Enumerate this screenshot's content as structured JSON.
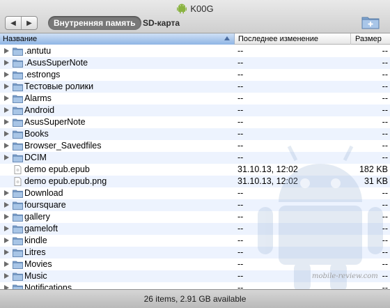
{
  "window": {
    "title": "K00G"
  },
  "toolbar": {
    "back_label": "◀",
    "forward_label": "▶",
    "tab_internal": "Внутренняя память",
    "tab_sd": "SD-карта"
  },
  "columns": {
    "name": "Название",
    "modified": "Последнее изменение",
    "size": "Размер"
  },
  "rows": [
    {
      "type": "folder",
      "name": ".antutu",
      "modified": "--",
      "size": "--"
    },
    {
      "type": "folder",
      "name": ".AsusSuperNote",
      "modified": "--",
      "size": "--"
    },
    {
      "type": "folder",
      "name": ".estrongs",
      "modified": "--",
      "size": "--"
    },
    {
      "type": "folder",
      "name": "Тестовые ролики",
      "modified": "--",
      "size": "--"
    },
    {
      "type": "folder",
      "name": "Alarms",
      "modified": "--",
      "size": "--"
    },
    {
      "type": "folder",
      "name": "Android",
      "modified": "--",
      "size": "--"
    },
    {
      "type": "folder",
      "name": "AsusSuperNote",
      "modified": "--",
      "size": "--"
    },
    {
      "type": "folder",
      "name": "Books",
      "modified": "--",
      "size": "--"
    },
    {
      "type": "folder",
      "name": "Browser_Savedfiles",
      "modified": "--",
      "size": "--"
    },
    {
      "type": "folder",
      "name": "DCIM",
      "modified": "--",
      "size": "--"
    },
    {
      "type": "file",
      "name": "demo epub.epub",
      "modified": "31.10.13, 12:02",
      "size": "182 KB"
    },
    {
      "type": "file",
      "name": "demo epub.epub.png",
      "modified": "31.10.13, 12:02",
      "size": "31 KB"
    },
    {
      "type": "folder",
      "name": "Download",
      "modified": "--",
      "size": "--"
    },
    {
      "type": "folder",
      "name": "foursquare",
      "modified": "--",
      "size": "--"
    },
    {
      "type": "folder",
      "name": "gallery",
      "modified": "--",
      "size": "--"
    },
    {
      "type": "folder",
      "name": "gameloft",
      "modified": "--",
      "size": "--"
    },
    {
      "type": "folder",
      "name": "kindle",
      "modified": "--",
      "size": "--"
    },
    {
      "type": "folder",
      "name": "Litres",
      "modified": "--",
      "size": "--"
    },
    {
      "type": "folder",
      "name": "Movies",
      "modified": "--",
      "size": "--"
    },
    {
      "type": "folder",
      "name": "Music",
      "modified": "--",
      "size": "--"
    },
    {
      "type": "folder",
      "name": "Notifications",
      "modified": "--",
      "size": "--"
    }
  ],
  "watermark": "mobile-review.com",
  "status": {
    "text": "26 items, 2.91 GB available"
  },
  "colors": {
    "folder": "#8fb0d6",
    "header_sort": "#9fc0ea",
    "stripe": "#edf3fe"
  }
}
